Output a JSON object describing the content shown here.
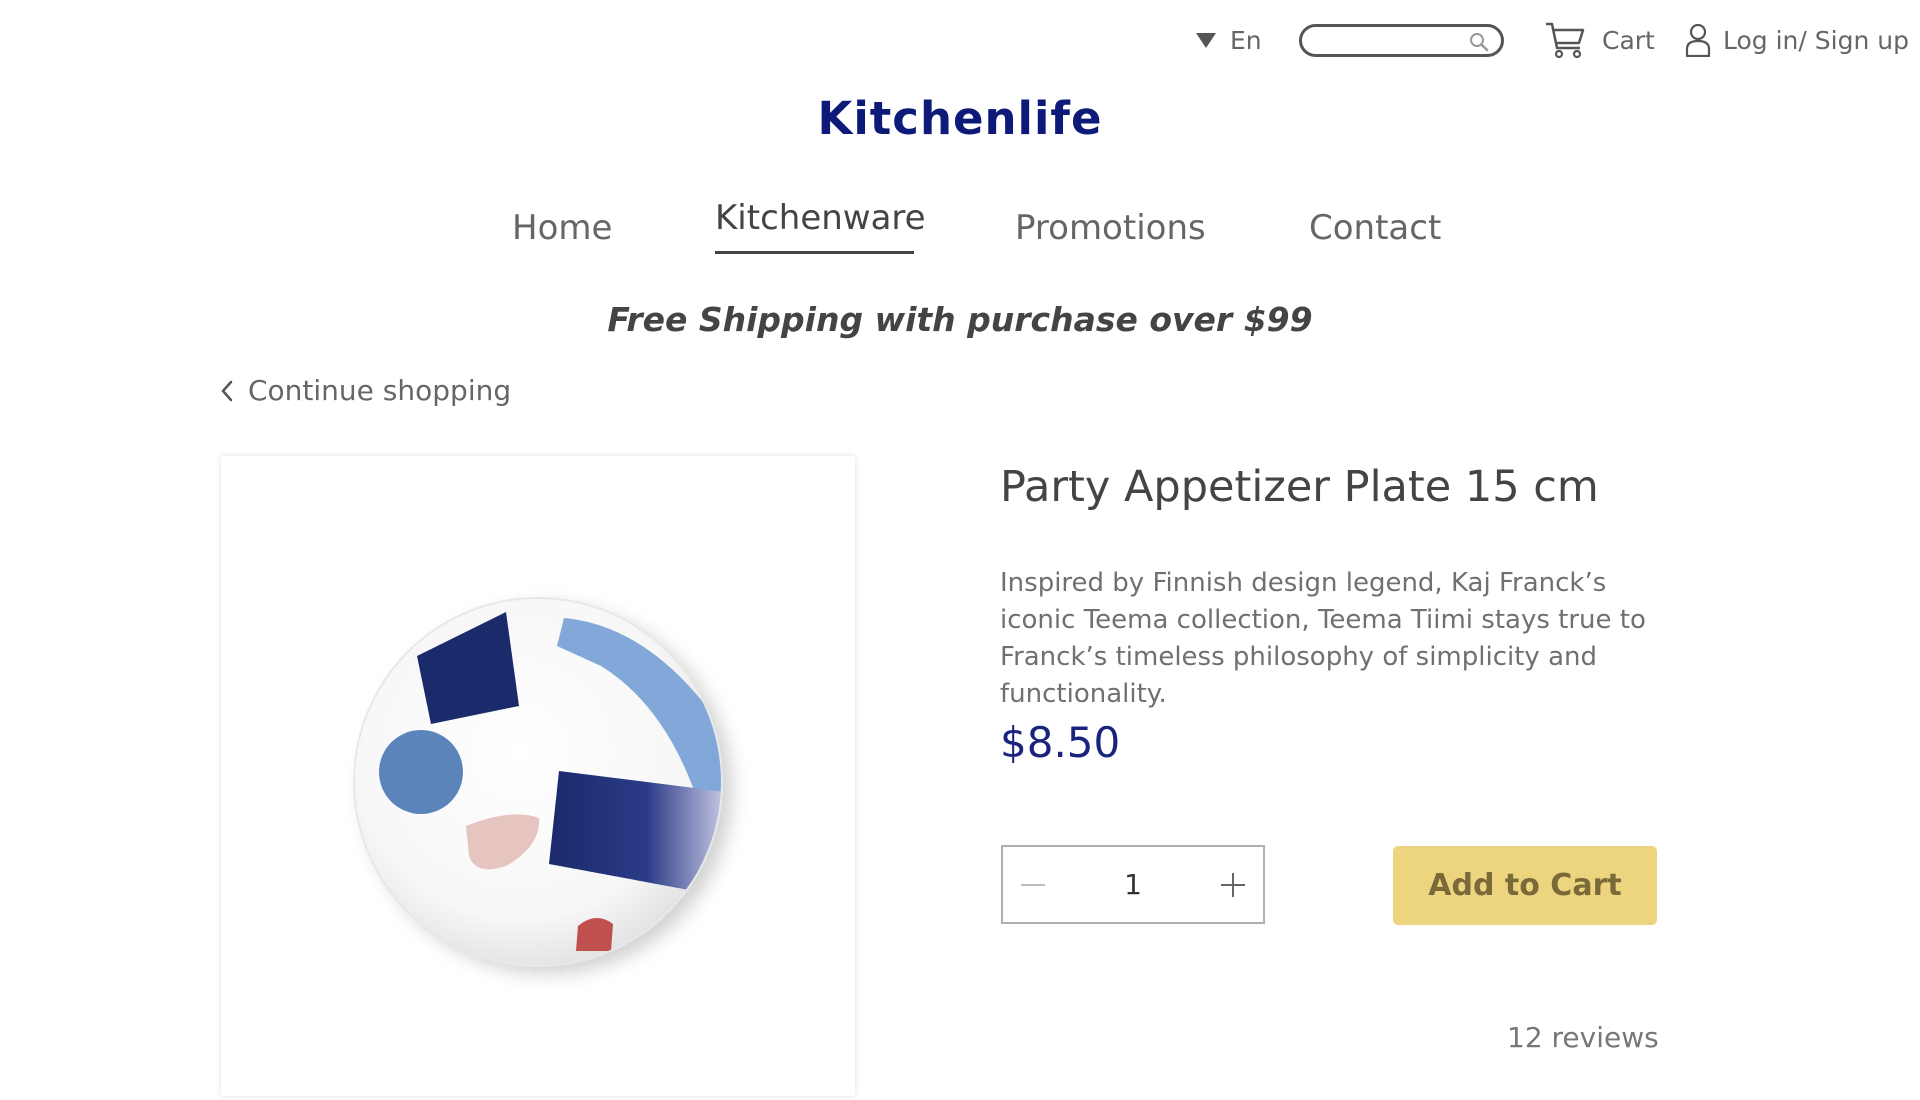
{
  "header": {
    "language": "En",
    "search_placeholder": "",
    "cart_label": "Cart",
    "login_label": "Log in/ Sign up"
  },
  "brand": {
    "logo_text": "Kitchenlife",
    "color": "#0d1a78"
  },
  "nav": {
    "items": [
      {
        "label": "Home"
      },
      {
        "label": "Kitchenware",
        "active": true
      },
      {
        "label": "Promotions"
      },
      {
        "label": "Contact"
      }
    ]
  },
  "banner": {
    "shipping": "Free Shipping with purchase over $99"
  },
  "breadcrumb": {
    "continue_label": "Continue shopping"
  },
  "product": {
    "title": "Party Appetizer Plate 15 cm",
    "description": "Inspired by Finnish design legend, Kaj Franck’s iconic Teema collection, Teema Tiimi stays true to Franck’s timeless philosophy of simplicity and functionality.",
    "price": "$8.50",
    "price_color": "#1a237e",
    "quantity": "1",
    "add_to_cart_label": "Add to Cart",
    "add_to_cart_color": "#ecd57e",
    "reviews": "12 reviews"
  }
}
